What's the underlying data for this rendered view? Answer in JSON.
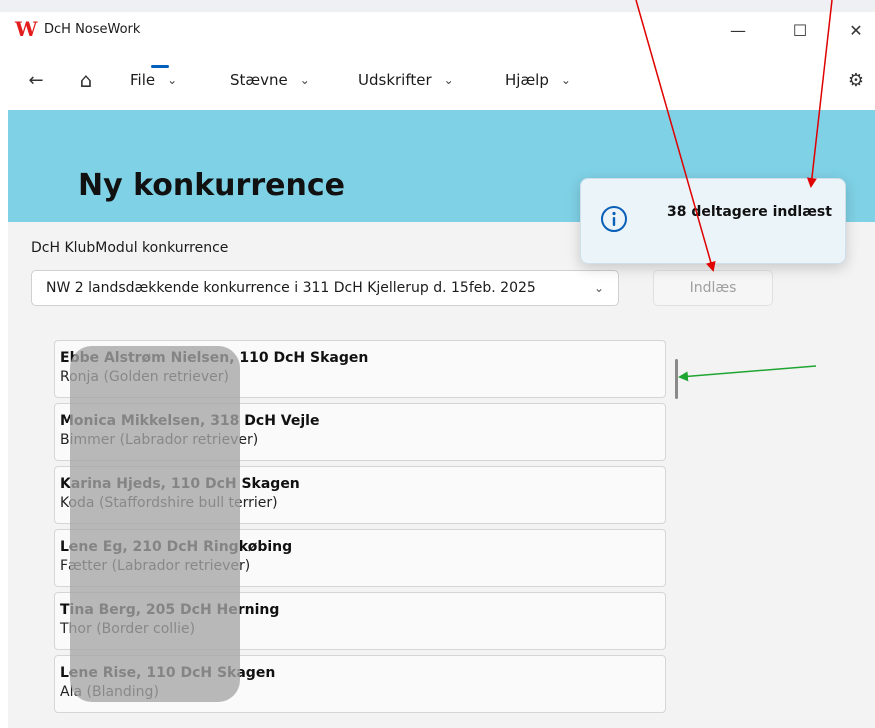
{
  "app": {
    "logo_letter": "W",
    "title": "DcH NoseWork"
  },
  "window_controls": {
    "minimize": "—",
    "maximize": "☐",
    "close": "✕"
  },
  "nav": {
    "back": "←",
    "home": "⌂",
    "menus": [
      {
        "label": "File",
        "chev": "⌄"
      },
      {
        "label": "Stævne",
        "chev": "⌄"
      },
      {
        "label": "Udskrifter",
        "chev": "⌄"
      },
      {
        "label": "Hjælp",
        "chev": "⌄"
      }
    ],
    "settings": "⚙"
  },
  "page": {
    "title": "Ny konkurrence",
    "klub_label": "DcH KlubModul konkurrence",
    "competition_selected": "NW 2 landsdækkende konkurrence i 311 DcH Kjellerup d. 15feb. 2025",
    "competition_chev": "⌄",
    "load_button": "Indlæs"
  },
  "participants": [
    {
      "handler": "Ebbe Alstrøm Nielsen, 110 DcH Skagen",
      "dog": "Ronja (Golden retriever)"
    },
    {
      "handler": "Monica Mikkelsen, 318 DcH Vejle",
      "dog": "Bimmer (Labrador retriever)"
    },
    {
      "handler": "Karina Hjeds, 110 DcH Skagen",
      "dog": "Koda (Staffordshire bull terrier)"
    },
    {
      "handler": "Lene Eg, 210 DcH Ringkøbing",
      "dog": "Fætter (Labrador retriever)"
    },
    {
      "handler": "Tina Berg, 205 DcH Herning",
      "dog": "Thor (Border collie)"
    },
    {
      "handler": "Lene Rise, 110 DcH Skagen",
      "dog": "Ala (Blanding)"
    }
  ],
  "toast": {
    "message": "38 deltagere indlæst",
    "icon": "info-icon"
  },
  "colors": {
    "header_band": "#7fd1e6",
    "logo_red": "#e21c1c",
    "accent_blue": "#005fb8",
    "annotation_red": "#e00000",
    "annotation_green": "#1fa531"
  }
}
